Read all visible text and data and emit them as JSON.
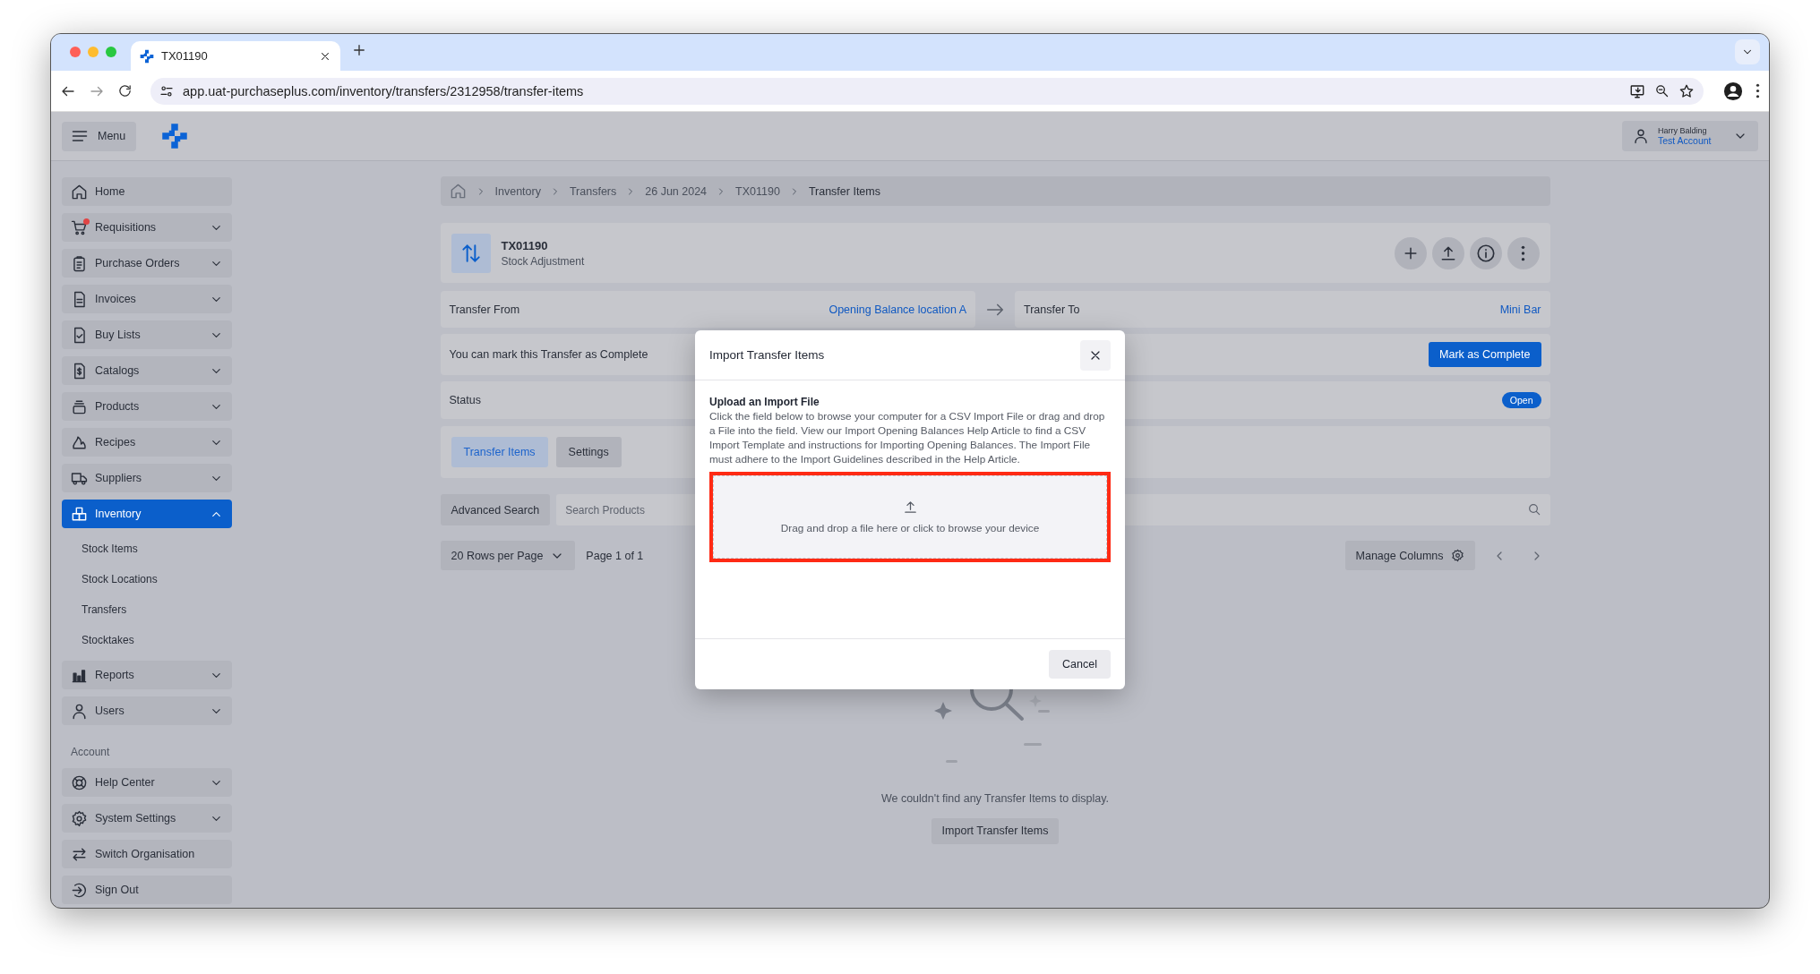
{
  "browser": {
    "tab_title": "TX01190",
    "url": "app.uat-purchaseplus.com/inventory/transfers/2312958/transfer-items"
  },
  "header": {
    "menu_label": "Menu",
    "user": {
      "name": "Harry Balding",
      "account": "Test Account"
    }
  },
  "sidebar": {
    "items": [
      {
        "label": "Home",
        "expandable": false,
        "selected": false,
        "alert": false
      },
      {
        "label": "Requisitions",
        "expandable": true,
        "expanded": false,
        "selected": false,
        "alert": true
      },
      {
        "label": "Purchase Orders",
        "expandable": true,
        "expanded": false,
        "selected": false,
        "alert": false
      },
      {
        "label": "Invoices",
        "expandable": true,
        "expanded": false,
        "selected": false,
        "alert": false
      },
      {
        "label": "Buy Lists",
        "expandable": true,
        "expanded": false,
        "selected": false,
        "alert": false
      },
      {
        "label": "Catalogs",
        "expandable": true,
        "expanded": false,
        "selected": false,
        "alert": false
      },
      {
        "label": "Products",
        "expandable": true,
        "expanded": false,
        "selected": false,
        "alert": false
      },
      {
        "label": "Recipes",
        "expandable": true,
        "expanded": false,
        "selected": false,
        "alert": false
      },
      {
        "label": "Suppliers",
        "expandable": true,
        "expanded": false,
        "selected": false,
        "alert": false
      },
      {
        "label": "Inventory",
        "expandable": true,
        "expanded": true,
        "selected": true,
        "alert": false,
        "children": [
          {
            "label": "Stock Items",
            "selected": false
          },
          {
            "label": "Stock Locations",
            "selected": false
          },
          {
            "label": "Transfers",
            "selected": false
          },
          {
            "label": "Stocktakes",
            "selected": false
          }
        ]
      },
      {
        "label": "Reports",
        "expandable": true,
        "expanded": false,
        "selected": false,
        "alert": false
      },
      {
        "label": "Users",
        "expandable": true,
        "expanded": false,
        "selected": false,
        "alert": false
      }
    ],
    "account": {
      "label": "Account",
      "items": [
        {
          "label": "Help Center",
          "expandable": true,
          "expanded": false,
          "selected": false
        },
        {
          "label": "System Settings",
          "expandable": true,
          "expanded": false,
          "selected": false
        },
        {
          "label": "Switch Organisation",
          "expandable": false,
          "selected": false
        },
        {
          "label": "Sign Out",
          "expandable": false,
          "selected": false
        }
      ]
    }
  },
  "breadcrumb": [
    "Inventory",
    "Transfers",
    "26 Jun 2024",
    "TX01190",
    "Transfer Items"
  ],
  "transfer": {
    "code": "TX01190",
    "type": "Stock Adjustment",
    "from_label": "Transfer From",
    "from_value": "Opening Balance location A",
    "to_label": "Transfer To",
    "to_value": "Mini Bar"
  },
  "complete_notice": {
    "text": "You can mark this Transfer as Complete",
    "button": "Mark as Complete"
  },
  "status": {
    "label": "Status",
    "value": "Open"
  },
  "tabs": [
    {
      "label": "Transfer Items",
      "selected": true
    },
    {
      "label": "Settings",
      "selected": false
    }
  ],
  "search": {
    "button": "Advanced Search",
    "placeholder": "Search Products"
  },
  "pagination": {
    "rows_per_page": "20 Rows per Page",
    "page": "Page 1 of 1",
    "manage_columns": "Manage Columns"
  },
  "empty_state": {
    "message": "We couldn't find any Transfer Items to display.",
    "button": "Import Transfer Items"
  },
  "modal": {
    "title": "Import Transfer Items",
    "heading": "Upload an Import File",
    "description": "Click the field below to browse your computer for a CSV Import File or drag and drop a File into the field. View our Import Opening Balances Help Article to find a CSV Import Template and instructions for Importing Opening Balances. The Import File must adhere to the Import Guidelines described in the Help Article.",
    "dropzone": {
      "text": "Drag and drop a file here or click to browse your device",
      "highlighted": true
    },
    "cancel": "Cancel"
  }
}
